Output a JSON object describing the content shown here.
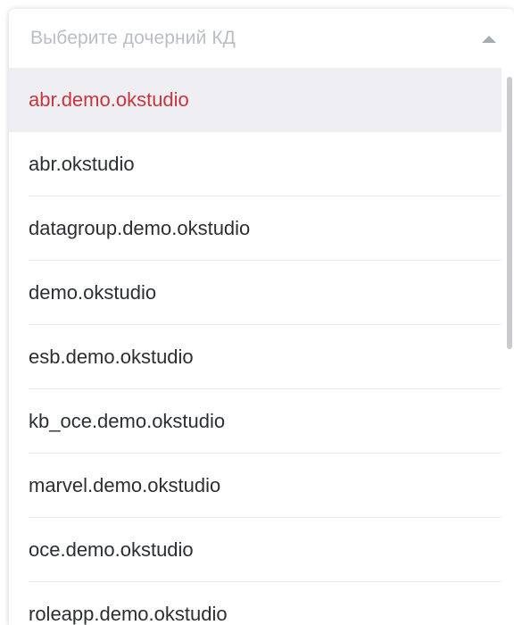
{
  "dropdown": {
    "placeholder": "Выберите дочерний КД",
    "caret_icon": "caret-up-icon",
    "selected_color": "#c8353d",
    "items": [
      {
        "label": "abr.demo.okstudio",
        "selected": true
      },
      {
        "label": "abr.okstudio",
        "selected": false
      },
      {
        "label": "datagroup.demo.okstudio",
        "selected": false
      },
      {
        "label": "demo.okstudio",
        "selected": false
      },
      {
        "label": "esb.demo.okstudio",
        "selected": false
      },
      {
        "label": "kb_oce.demo.okstudio",
        "selected": false
      },
      {
        "label": "marvel.demo.okstudio",
        "selected": false
      },
      {
        "label": "oce.demo.okstudio",
        "selected": false
      },
      {
        "label": "roleapp.demo.okstudio",
        "selected": false
      }
    ]
  }
}
